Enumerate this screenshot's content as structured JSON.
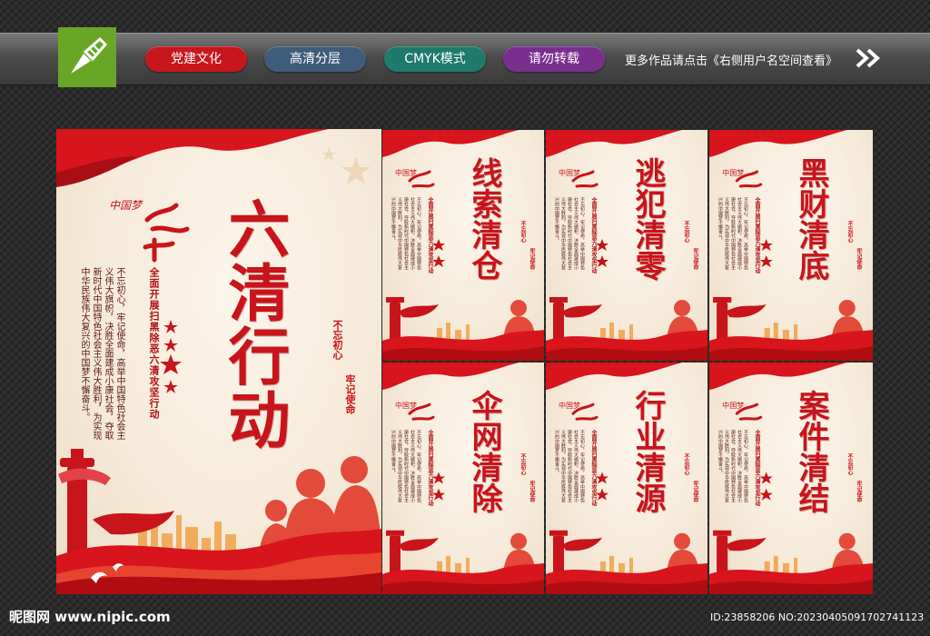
{
  "header": {
    "tags": [
      {
        "label": "党建文化",
        "color": "#c8161d"
      },
      {
        "label": "高清分层",
        "color": "#3f5d7a"
      },
      {
        "label": "CMYK模式",
        "color": "#1e7a6c"
      },
      {
        "label": "请勿转载",
        "color": "#7a2f8f"
      }
    ],
    "more_text": "更多作品请点击《右侧用户名空间查看》"
  },
  "main_poster": {
    "title": "六清行动",
    "subtitle": "全面开展扫黑除恶六清攻坚行动",
    "body": "不忘初心，牢记使命，高举中国特色社会主义伟大旗帜，决胜全面建成小康社会，夺取新时代中国特色社会主义伟大胜利，为实现中华民族伟大复兴的中国梦不懈奋斗。",
    "slogan_left": "不忘初心",
    "slogan_right": "牢记使命"
  },
  "small_posters": [
    {
      "title": "线索清仓"
    },
    {
      "title": "逃犯清零"
    },
    {
      "title": "黑财清底"
    },
    {
      "title": "伞网清除"
    },
    {
      "title": "行业清源"
    },
    {
      "title": "案件清结"
    }
  ],
  "footer": {
    "site": "昵图网 www.nipic.com",
    "id_text": "ID:23858206 NO:20230405091702741123"
  },
  "colors": {
    "party_red": "#c8141b",
    "poster_bg": "#f6ead9",
    "logo_green": "#6aa626"
  }
}
